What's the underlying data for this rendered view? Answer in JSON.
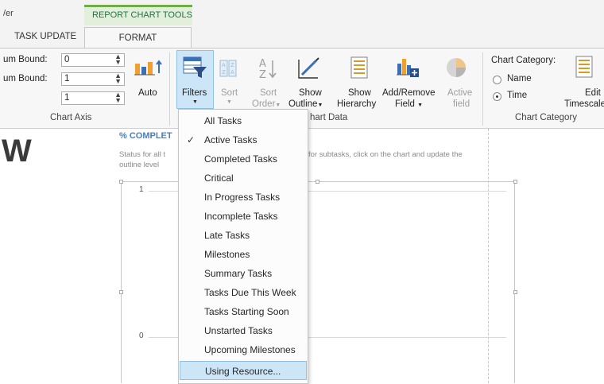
{
  "tabs": {
    "left_fragment": "/er",
    "context_header": "REPORT CHART TOOLS",
    "task_update": "TASK UPDATE",
    "format": "FORMAT"
  },
  "ribbon": {
    "chart_axis": {
      "min_label": "um Bound:",
      "min_value": "0",
      "max_label": "um Bound:",
      "max_value": "1",
      "interval_value": "1",
      "auto_label": "Auto",
      "group_label": "Chart Axis"
    },
    "chart_data": {
      "filters_label": "Filters",
      "sort_label": "Sort",
      "sort_order_label": "Sort",
      "sort_order_label2": "Order",
      "show_outline_label": "Show",
      "show_outline_label2": "Outline",
      "show_hierarchy_label": "Show",
      "show_hierarchy_label2": "Hierarchy",
      "add_remove_label": "Add/Remove",
      "add_remove_label2": "Field",
      "active_field_label": "Active",
      "active_field_label2": "field",
      "group_label": "Chart Data",
      "group_label_visible": "hart Data"
    },
    "chart_category": {
      "title": "Chart Category:",
      "option_name": "Name",
      "option_time": "Time",
      "selected": "Time",
      "edit_timescale_label": "Edit",
      "edit_timescale_label2": "Timescale",
      "group_label": "Chart Category"
    }
  },
  "canvas": {
    "big_letter": "W",
    "chart_title": "% COMPLET",
    "subtitle_left_1": "Status for all t",
    "subtitle_left_2": "outline level",
    "subtitle_right": "for subtasks, click on the chart and update the",
    "axis_top": "1",
    "axis_bottom": "0"
  },
  "filters_menu": {
    "items": [
      "All Tasks",
      "Active Tasks",
      "Completed Tasks",
      "Critical",
      "In Progress Tasks",
      "Incomplete Tasks",
      "Late Tasks",
      "Milestones",
      "Summary Tasks",
      "Tasks Due This Week",
      "Tasks Starting Soon",
      "Unstarted Tasks",
      "Upcoming Milestones",
      "Using Resource..."
    ],
    "checked": "Active Tasks",
    "highlighted": "Using Resource..."
  },
  "colors": {
    "accent_green": "#217346",
    "highlight_blue": "#cde6f7",
    "title_blue": "#4a7ebb"
  }
}
